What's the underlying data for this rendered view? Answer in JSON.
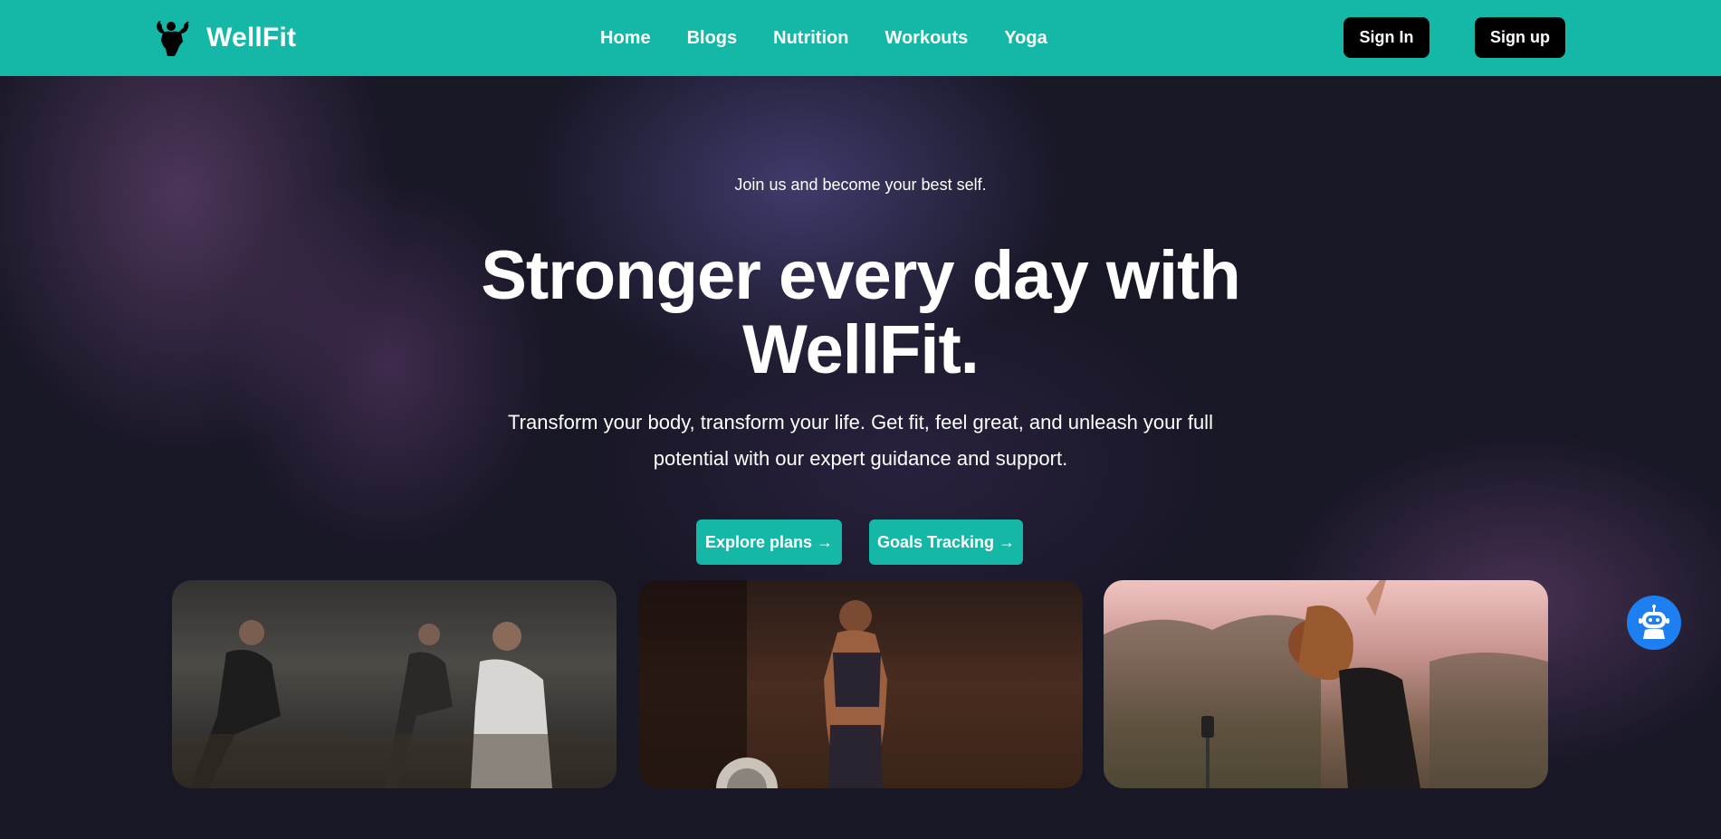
{
  "header": {
    "brand": "WellFit",
    "brand_icon": "flexing-man-icon",
    "nav": [
      {
        "label": "Home"
      },
      {
        "label": "Blogs"
      },
      {
        "label": "Nutrition"
      },
      {
        "label": "Workouts"
      },
      {
        "label": "Yoga"
      }
    ],
    "sign_in_label": "Sign In",
    "sign_up_label": "Sign up",
    "accent_color": "#15b8a6"
  },
  "hero": {
    "eyebrow": "Join us and become your best self.",
    "headline_line1": "Stronger every day with",
    "headline_line2": "WellFit.",
    "subtext": "Transform your body, transform your life. Get fit, feel great, and unleash your full potential with our expert guidance and support.",
    "cta_explore": "Explore plans →",
    "cta_goals": "Goals Tracking →"
  },
  "chatbot": {
    "icon": "robot-icon",
    "color": "#1e80f0"
  },
  "cards": [
    {
      "image": "women-yoga-group-photo"
    },
    {
      "image": "woman-weightlifting-photo"
    },
    {
      "image": "woman-outdoor-yoga-photo"
    }
  ]
}
